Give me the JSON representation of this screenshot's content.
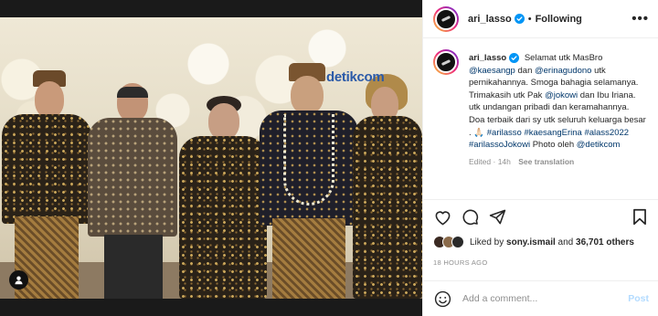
{
  "post": {
    "username": "ari_lasso",
    "follow_status": "Following",
    "more_label": "•••",
    "photo_watermark": "detikcom"
  },
  "caption": {
    "username": "ari_lasso",
    "parts": {
      "p1": "Selamat utk MasBro",
      "m1": "@kaesangp",
      "p2": "dan",
      "m2": "@erinagudono",
      "p3": "utk pernikahannya. Smoga bahagia selamanya. Trimakasih utk Pak",
      "m3": "@jokowi",
      "p4": "dan Ibu Iriana. utk undangan pribadi dan keramahannya. Doa terbaik dari sy utk seluruh keluarga besar .",
      "emoji": "🙏🏻",
      "h1": "#arilasso",
      "h2": "#kaesangErina",
      "h3": "#alass2022",
      "h4": "#arilassoJokowi",
      "p5": "Photo oleh",
      "m4": "@detikcom"
    },
    "edited": "Edited",
    "dot": "·",
    "age": "14h",
    "see_translation": "See translation"
  },
  "likes": {
    "prefix": "Liked by",
    "user": "sony.ismail",
    "and": "and",
    "others": "36,701 others"
  },
  "timestamp": "18 HOURS AGO",
  "comment": {
    "placeholder": "Add a comment...",
    "post_label": "Post"
  },
  "colors": {
    "verified": "#0095f6",
    "link": "#00376b",
    "post_disabled": "#b3dbff",
    "meta": "#8e8e8e"
  },
  "icons": [
    "verified-badge-icon",
    "heart-icon",
    "comment-icon",
    "share-icon",
    "bookmark-icon",
    "emoji-icon",
    "user-tag-icon"
  ]
}
